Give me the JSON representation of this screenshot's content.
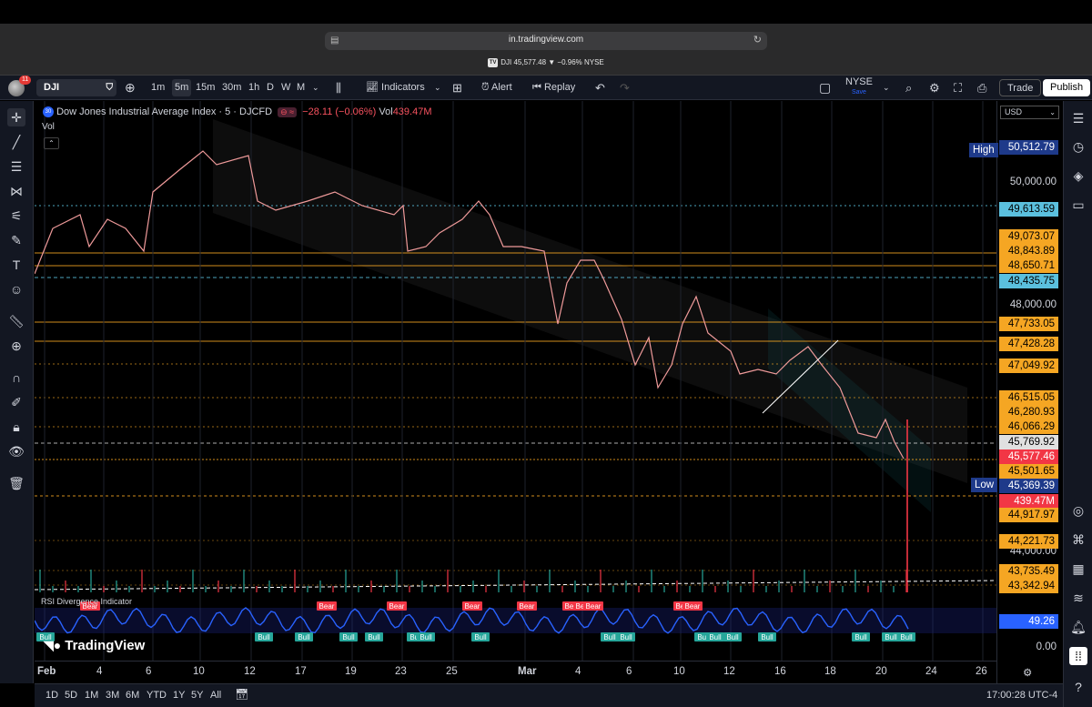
{
  "browser": {
    "url": "in.tradingview.com",
    "tab_title": "DJI 45,577.48 ▼ −0.96% NYSE",
    "tab_badge": "TV"
  },
  "toolbar": {
    "notifications": "11",
    "symbol": "DJI",
    "intervals": [
      "1m",
      "5m",
      "15m",
      "30m",
      "1h",
      "D",
      "W",
      "M"
    ],
    "active_interval": "5m",
    "indicators_label": "Indicators",
    "alert_label": "Alert",
    "replay_label": "Replay",
    "exchange": "NYSE",
    "save_label": "Save",
    "trade_label": "Trade",
    "publish_label": "Publish"
  },
  "legend": {
    "title": "Dow Jones Industrial Average Index · 5 · DJCFD",
    "icon_text": "30",
    "change": "−28.11 (−0.06%)",
    "vol_label": "Vol",
    "vol_value": "439.47M",
    "vol_pane_label": "Vol",
    "rsi_label": "RSI Divergence Indicator"
  },
  "price_scale": {
    "currency": "USD",
    "ticks": [
      "50,000.00",
      "48,000.00",
      "44,000.00",
      "0.00"
    ],
    "labels": [
      {
        "text": "50,512.79",
        "color": "#1e3a8a",
        "fg": "#ffffff"
      },
      {
        "text": "49,613.59",
        "color": "#5bc0de",
        "fg": "#000000"
      },
      {
        "text": "49,073.07",
        "color": "#f5a623",
        "fg": "#000000"
      },
      {
        "text": "48,843.89",
        "color": "#f5a623",
        "fg": "#000000"
      },
      {
        "text": "48,650.71",
        "color": "#f5a623",
        "fg": "#000000"
      },
      {
        "text": "48,435.75",
        "color": "#5bc0de",
        "fg": "#000000"
      },
      {
        "text": "47,733.05",
        "color": "#f5a623",
        "fg": "#000000"
      },
      {
        "text": "47,428.28",
        "color": "#f5a623",
        "fg": "#000000"
      },
      {
        "text": "47,049.92",
        "color": "#f5a623",
        "fg": "#000000"
      },
      {
        "text": "46,515.05",
        "color": "#f5a623",
        "fg": "#000000"
      },
      {
        "text": "46,280.93",
        "color": "#f5a623",
        "fg": "#000000"
      },
      {
        "text": "46,066.29",
        "color": "#f5a623",
        "fg": "#000000"
      },
      {
        "text": "45,769.92",
        "color": "#e0e0e0",
        "fg": "#000000"
      },
      {
        "text": "45,577.46",
        "color": "#f23645",
        "fg": "#ffffff"
      },
      {
        "text": "45,501.65",
        "color": "#f5a623",
        "fg": "#000000"
      },
      {
        "text": "45,369.39",
        "color": "#1e3a8a",
        "fg": "#ffffff"
      },
      {
        "text": "439.47M",
        "color": "#f23645",
        "fg": "#ffffff"
      },
      {
        "text": "44,917.97",
        "color": "#f5a623",
        "fg": "#000000"
      },
      {
        "text": "44,221.73",
        "color": "#f5a623",
        "fg": "#000000"
      },
      {
        "text": "43,735.49",
        "color": "#f5a623",
        "fg": "#000000"
      },
      {
        "text": "43,342.94",
        "color": "#f5a623",
        "fg": "#000000"
      },
      {
        "text": "49.26",
        "color": "#2962ff",
        "fg": "#ffffff"
      }
    ],
    "high_label": "High",
    "low_label": "Low"
  },
  "time_axis": [
    "Feb",
    "4",
    "6",
    "10",
    "12",
    "17",
    "19",
    "23",
    "25",
    "Mar",
    "4",
    "6",
    "10",
    "12",
    "16",
    "18",
    "20",
    "24",
    "26"
  ],
  "bottom_bar": {
    "ranges": [
      "1D",
      "5D",
      "1M",
      "3M",
      "6M",
      "YTD",
      "1Y",
      "5Y",
      "All"
    ],
    "clock": "17:00:28 UTC-4"
  },
  "rsi_markers": {
    "bear_label": "Bear",
    "bull_label": "Bull"
  },
  "branding": "TradingView",
  "colors": {
    "background": "#000000",
    "toolbar": "#131722",
    "up": "#26a69a",
    "down": "#f23645",
    "orange_level": "#f5a623",
    "rsi_line": "#2962ff"
  }
}
